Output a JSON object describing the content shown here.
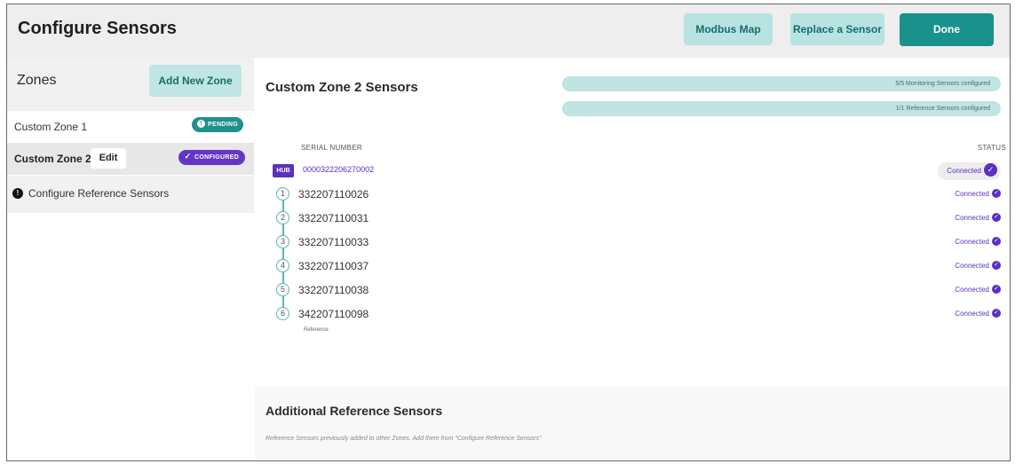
{
  "header": {
    "title": "Configure Sensors",
    "modbus_label": "Modbus Map",
    "replace_label": "Replace a Sensor",
    "done_label": "Done"
  },
  "sidebar": {
    "zones_label": "Zones",
    "add_zone_label": "Add New Zone",
    "zones": [
      {
        "name": "Custom Zone 1",
        "badge": "PENDING",
        "badge_icon": "!"
      },
      {
        "name": "Custom Zone 2",
        "edit_label": "Edit",
        "badge": "CONFIGURED",
        "badge_icon": "✓",
        "active": true
      }
    ],
    "reference_icon": "!",
    "reference_label": "Configure Reference Sensors"
  },
  "main": {
    "zone_title": "Custom Zone 2 Sensors",
    "progress": [
      {
        "text": "5/5 Monitoring Sensors configured",
        "done": 5,
        "total": 5
      },
      {
        "text": "1/1 Reference Sensors configured",
        "done": 1,
        "total": 1
      }
    ],
    "col_serial": "SERIAL NUMBER",
    "col_status": "STATUS",
    "hub": {
      "tag": "HUB",
      "serial": "0000322206270002",
      "status": "Connected"
    },
    "sensors": [
      {
        "index": "1",
        "serial": "332207110026",
        "status": "Connected"
      },
      {
        "index": "2",
        "serial": "332207110031",
        "status": "Connected"
      },
      {
        "index": "3",
        "serial": "332207110033",
        "status": "Connected"
      },
      {
        "index": "4",
        "serial": "332207110037",
        "status": "Connected"
      },
      {
        "index": "5",
        "serial": "332207110038",
        "status": "Connected"
      },
      {
        "index": "6",
        "serial": "342207110098",
        "status": "Connected",
        "sub": "Reference"
      }
    ],
    "additional_title": "Additional Reference Sensors",
    "additional_note": "Reference Sensors previously added to other Zones. Add them from \"Configure Reference Sensors\""
  },
  "colors": {
    "teal": "#1a918c",
    "teal_light": "#b7e3e1",
    "purple": "#5b2fc0"
  }
}
